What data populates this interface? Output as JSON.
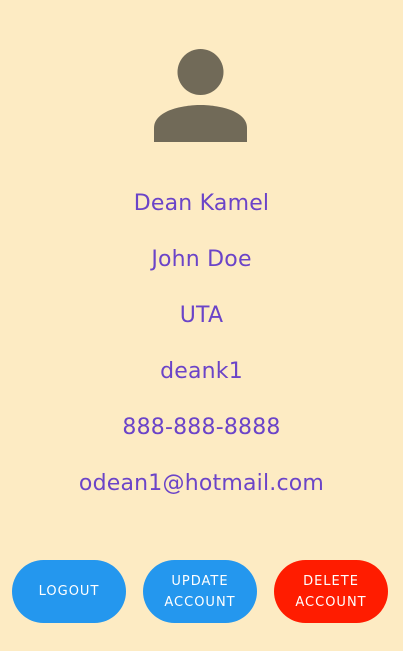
{
  "profile": {
    "avatar_icon": "person-icon",
    "display_name": "Dean Kamel",
    "full_name": "John Doe",
    "organization": "UTA",
    "username": "deank1",
    "phone": "888-888-8888",
    "email": "odean1@hotmail.com"
  },
  "actions": {
    "logout_label": "LOGOUT",
    "update_label": "UPDATE ACCOUNT",
    "delete_label": "DELETE ACCOUNT"
  },
  "colors": {
    "background": "#fdebc3",
    "text": "#6b44c8",
    "icon": "#716a58",
    "primary_button": "#2497ee",
    "danger_button": "#ff1c00"
  }
}
